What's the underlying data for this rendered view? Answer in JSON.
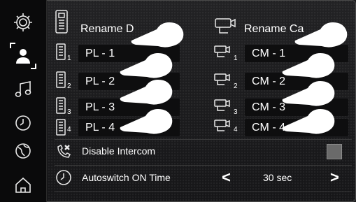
{
  "sidebar": {
    "items": [
      {
        "name": "settings-gear-icon"
      },
      {
        "name": "user-profile-icon"
      },
      {
        "name": "music-note-icon"
      },
      {
        "name": "clock-icon"
      },
      {
        "name": "globe-icon"
      },
      {
        "name": "home-icon"
      }
    ]
  },
  "header": {
    "rename_door_label": "Rename D",
    "rename_camera_label": "Rename Ca"
  },
  "doors": [
    {
      "index": "1",
      "value": "PL - 1"
    },
    {
      "index": "2",
      "value": "PL - 2"
    },
    {
      "index": "3",
      "value": "PL - 3"
    },
    {
      "index": "4",
      "value": "PL - 4"
    }
  ],
  "cameras": [
    {
      "index": "1",
      "value": "CM - 1"
    },
    {
      "index": "2",
      "value": "CM - 2"
    },
    {
      "index": "3",
      "value": "CM - 3"
    },
    {
      "index": "4",
      "value": "CM - 4"
    }
  ],
  "settings": {
    "disable_intercom_label": "Disable Intercom",
    "autoswitch_label": "Autoswitch ON Time",
    "autoswitch_value": "30  sec",
    "prev_arrow": "<",
    "next_arrow": ">"
  },
  "colors": {
    "background": "#1c1c1e",
    "sidebar": "#0a0a0b",
    "field": "#0e0e0f",
    "checkbox": "#6a6a6a"
  }
}
